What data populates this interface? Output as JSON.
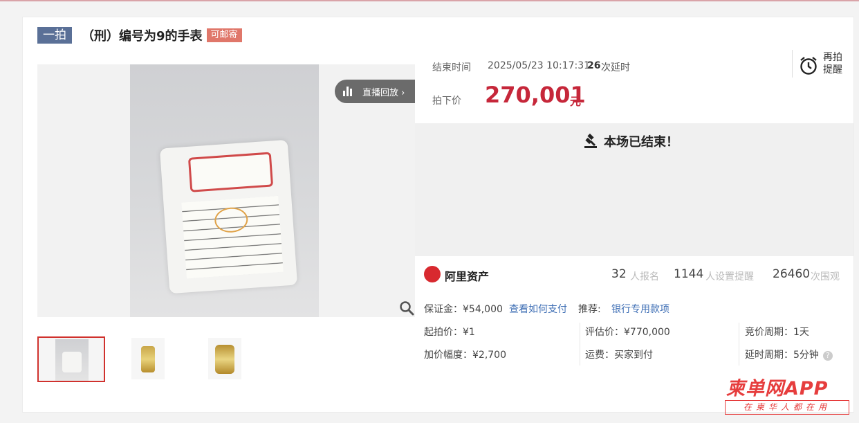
{
  "header": {
    "type_tag": "一拍",
    "title": "（刑）编号为9的手表",
    "mail_tag": "可邮寄"
  },
  "gallery": {
    "replay_label": "直播回放 ›",
    "thumbnails": [
      "thumb-1",
      "thumb-2",
      "thumb-3"
    ],
    "selected_index": 0
  },
  "auction": {
    "end_time_label": "结束时间",
    "end_time": "2025/05/23 10:17:31",
    "delay_count": "26",
    "delay_label": "次延时",
    "remind_label_1": "再拍",
    "remind_label_2": "提醒",
    "price_label": "拍下价",
    "price": "270,001",
    "price_unit": "元",
    "ended_text": "本场已结束！"
  },
  "stats": {
    "platform": "阿里资产",
    "signup_count": "32",
    "signup_label": "人报名",
    "remind_count": "1144",
    "remind_label": "人设置提醒",
    "view_count": "26460",
    "view_label": "次围观"
  },
  "details": {
    "deposit": "保证金：¥54,000",
    "pay_link": "查看如何支付",
    "recommend_label": "推荐:",
    "recommend_link": "银行专用款项",
    "start_price": "起拍价：¥1",
    "appraisal": "评估价：¥770,000",
    "bid_cycle": "竞价周期：1天",
    "increment": "加价幅度：¥2,700",
    "shipping": "运费：买家到付",
    "delay_cycle": "延时周期：5分钟"
  },
  "watermark": {
    "brand": "柬单网APP",
    "slogan": "在柬华人都在用"
  },
  "colors": {
    "price_red": "#c6273a",
    "tag_blue": "#5a7097",
    "tag_orange": "#e0776a",
    "link_blue": "#3f6fb5"
  }
}
